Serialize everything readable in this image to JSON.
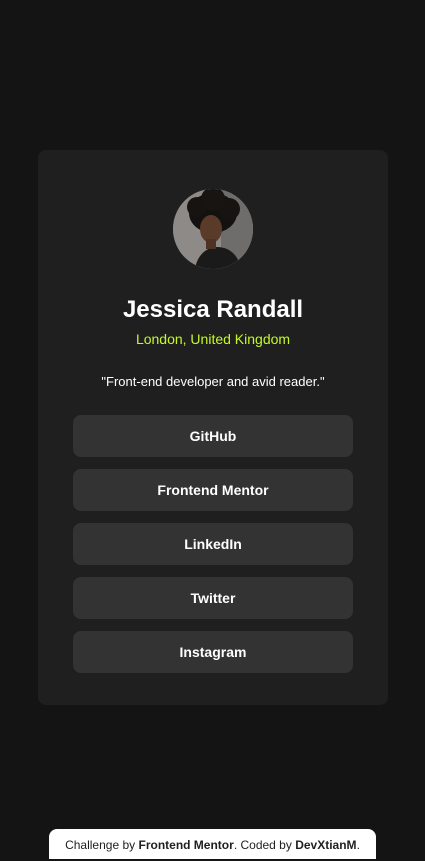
{
  "profile": {
    "name": "Jessica Randall",
    "location": "London, United Kingdom",
    "bio": "\"Front-end developer and avid reader.\""
  },
  "links": [
    {
      "label": "GitHub"
    },
    {
      "label": "Frontend Mentor"
    },
    {
      "label": "LinkedIn"
    },
    {
      "label": "Twitter"
    },
    {
      "label": "Instagram"
    }
  ],
  "attribution": {
    "prefix": "Challenge by",
    "challenge_link": "Frontend Mentor",
    "middle": ". Coded by",
    "author_link": "DevXtianM",
    "suffix": "."
  },
  "colors": {
    "background": "#141414",
    "card": "#1f1f1f",
    "button": "#333333",
    "accent": "#c4f82a",
    "text": "#ffffff"
  }
}
